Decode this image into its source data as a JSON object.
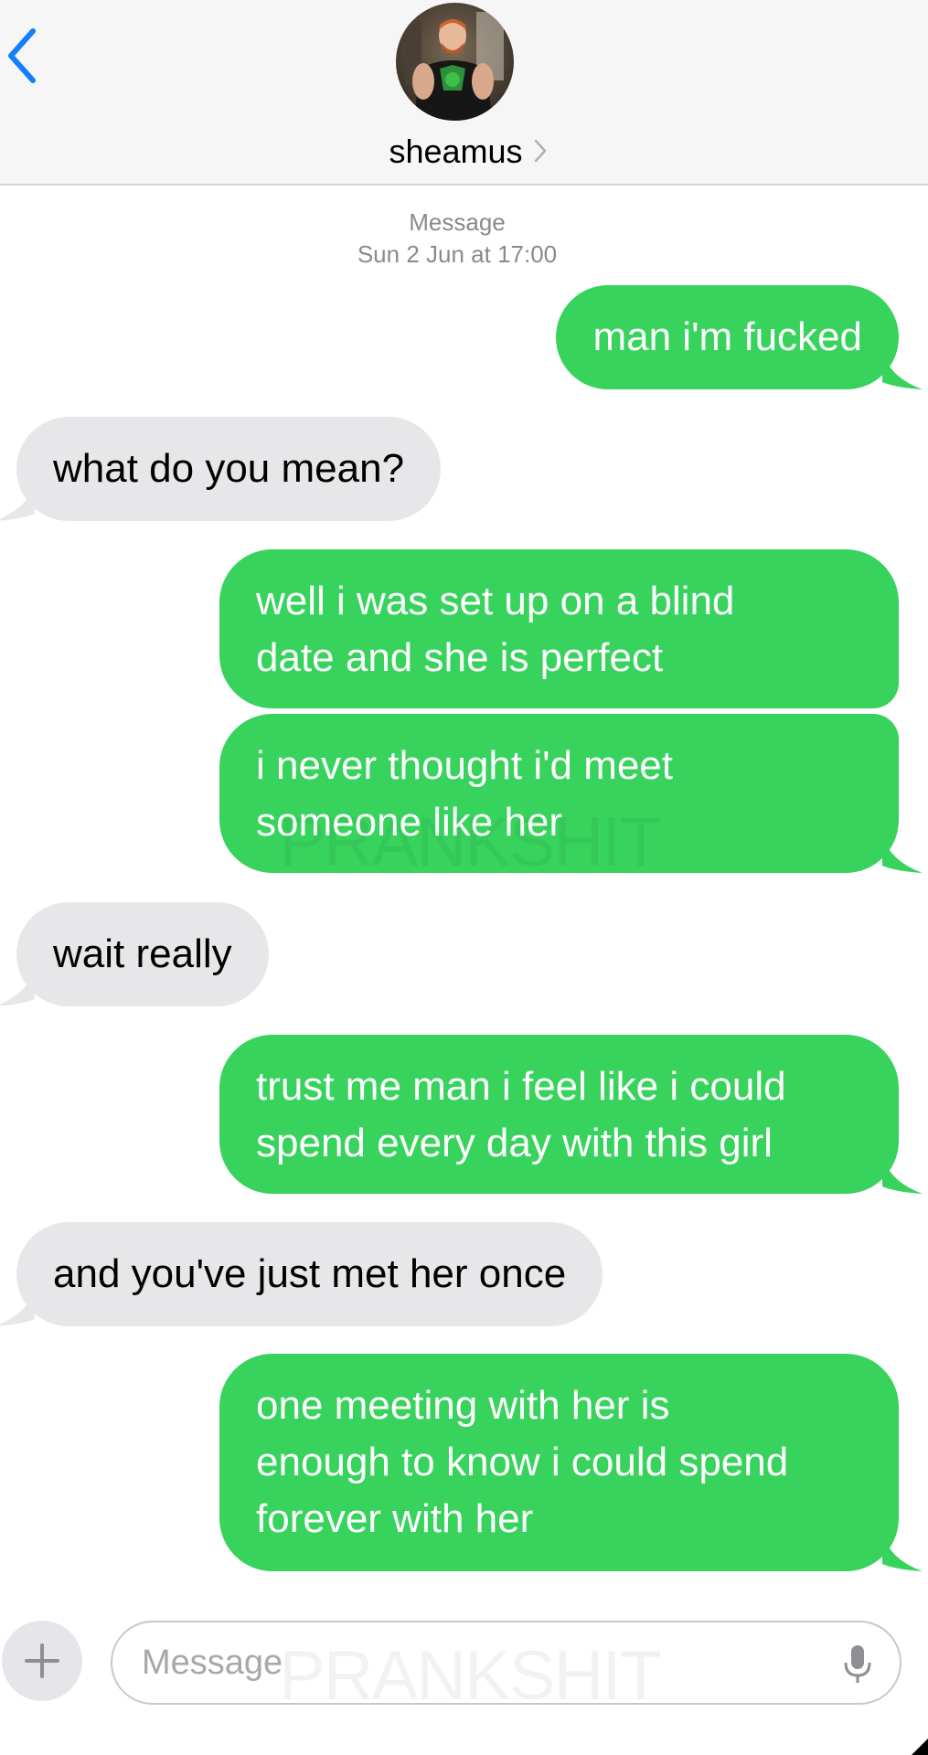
{
  "header": {
    "contact_name": "sheamus",
    "avatar": "contact-photo"
  },
  "timestamp": {
    "label": "Message",
    "date": "Sun 2 Jun at 17:00"
  },
  "messages": [
    {
      "from": "me",
      "text": "man i'm fucked"
    },
    {
      "from": "them",
      "text": "what do you mean?"
    },
    {
      "from": "me",
      "text": "well i was set up on a blind\ndate and she is perfect"
    },
    {
      "from": "me",
      "text": "i never thought i'd meet\nsomeone like her"
    },
    {
      "from": "them",
      "text": "wait really"
    },
    {
      "from": "me",
      "text": "trust me man i feel like i could\nspend every day with this girl"
    },
    {
      "from": "them",
      "text": "and you've just met her once"
    },
    {
      "from": "me",
      "text": "one meeting with her is\nenough to know i could spend\nforever with her"
    }
  ],
  "watermark": "PRANKSHIT",
  "input": {
    "placeholder": "Message"
  },
  "colors": {
    "sent_bubble": "#37d35d",
    "received_bubble": "#e7e7ea",
    "accent": "#147efb",
    "header_bg": "#f6f6f6"
  }
}
